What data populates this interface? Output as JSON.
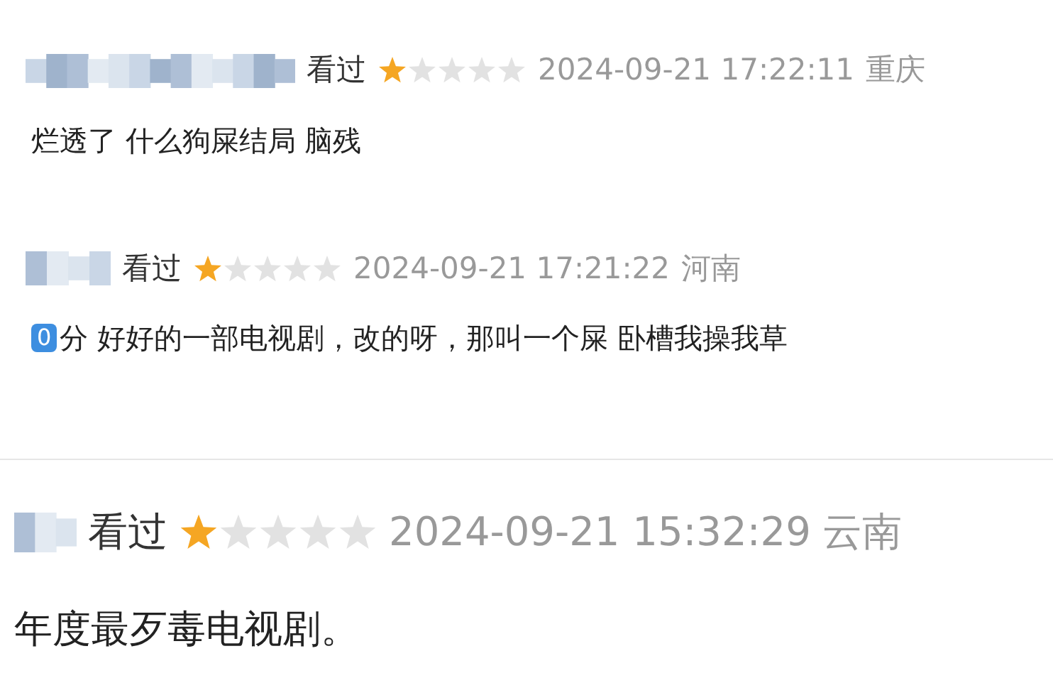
{
  "panels": [
    {
      "comments": [
        {
          "status": "看过",
          "stars": 1,
          "time": "2024-09-21 17:22:11",
          "location": "重庆",
          "text": "烂透了 什么狗屎结局 脑残"
        },
        {
          "status": "看过",
          "stars": 1,
          "time": "2024-09-21 17:21:22",
          "location": "河南",
          "keycap": "0",
          "text": "分 好好的一部电视剧，改的呀，那叫一个屎 卧槽我操我草"
        }
      ]
    },
    {
      "comments": [
        {
          "status": "看过",
          "stars": 1,
          "time": "2024-09-21 15:32:29",
          "location": "云南",
          "text": "年度最歹毒电视剧。"
        }
      ]
    }
  ]
}
